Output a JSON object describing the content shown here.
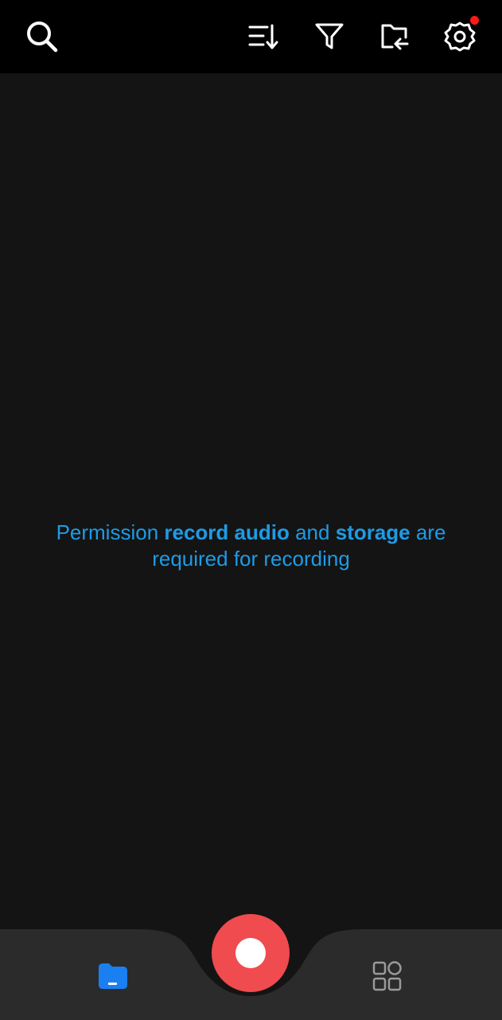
{
  "toolbar": {
    "icons": [
      "search-icon",
      "sort-icon",
      "filter-icon",
      "import-folder-icon",
      "settings-icon"
    ],
    "settings_has_notification": true
  },
  "message": {
    "part1": "Permission ",
    "bold1": "record audio",
    "part2": " and ",
    "bold2": "storage",
    "part3": " are required for recording"
  },
  "bottom_nav": {
    "icons": [
      "folder-icon",
      "record-icon",
      "apps-grid-icon"
    ]
  },
  "colors": {
    "background": "#141414",
    "topbar": "#000000",
    "bottom_bar": "#2b2b2b",
    "message_text": "#1e9be6",
    "record_button": "#f04b4e",
    "folder_icon": "#1a7ff0",
    "notification_dot": "#ff1a1a",
    "icon_white": "#ffffff",
    "icon_gray": "#9a9a9a"
  }
}
